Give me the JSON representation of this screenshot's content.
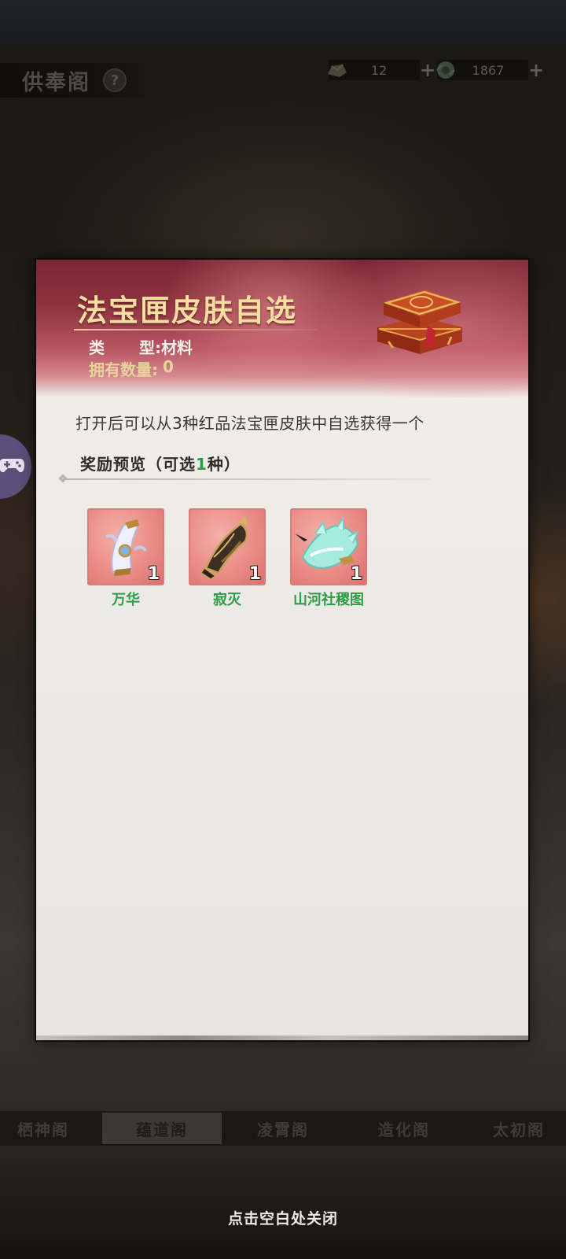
{
  "page": {
    "title": "供奉阁",
    "help_icon": "question-mark-icon"
  },
  "currencies": [
    {
      "icon": "gold-ingot-icon",
      "value": "12"
    },
    {
      "icon": "jade-token-icon",
      "value": "1867"
    }
  ],
  "modal": {
    "title": "法宝匣皮肤自选",
    "type_label_1": "类",
    "type_label_2": "型:",
    "type_value": "材料",
    "own_label": "拥有数量:",
    "own_value": "0",
    "description": "打开后可以从3种红品法宝匣皮肤中自选获得一个",
    "reward_head_prefix": "奖励预览（可选",
    "reward_head_count": "1",
    "reward_head_suffix": "种）",
    "items": [
      {
        "name": "万华",
        "count": "1",
        "icon": "scroll-artifact-icon"
      },
      {
        "name": "寂灭",
        "count": "1",
        "icon": "dark-scroll-artifact-icon"
      },
      {
        "name": "山河社稷图",
        "count": "1",
        "icon": "jade-scroll-artifact-icon"
      }
    ],
    "header_icon": "treasure-chest-icon"
  },
  "tabs": [
    {
      "label": "栖神阁",
      "active": false
    },
    {
      "label": "蕴道阁",
      "active": true
    },
    {
      "label": "凌霄阁",
      "active": false
    },
    {
      "label": "造化阁",
      "active": false
    },
    {
      "label": "太初阁",
      "active": false
    }
  ],
  "side_button_icon": "gamepad-icon",
  "close_hint": "点击空白处关闭",
  "colors": {
    "item_name": "#2b9c47",
    "title_gold": "#f6dea2",
    "header_red": "#8f3441"
  }
}
